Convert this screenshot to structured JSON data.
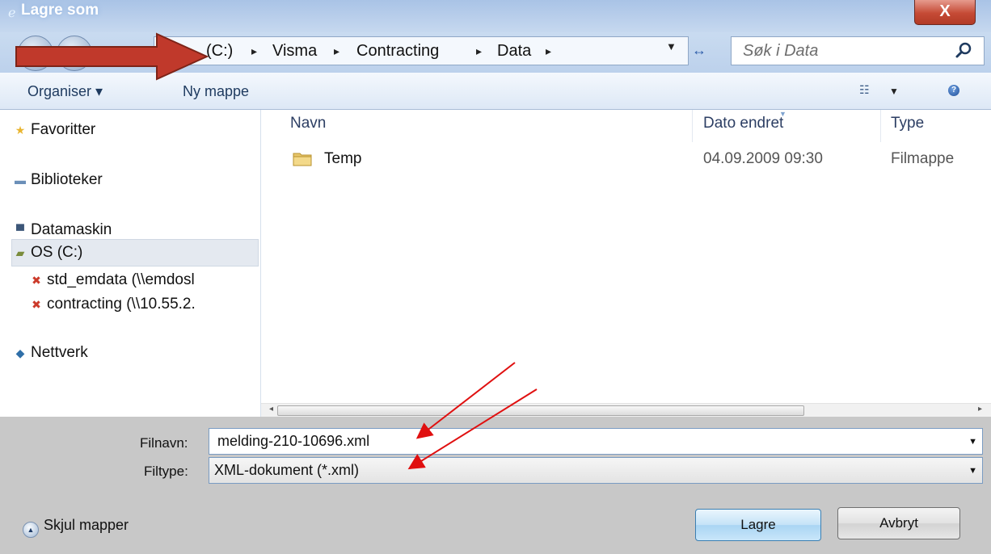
{
  "window": {
    "title": "Lagre som",
    "close_symbol": "X"
  },
  "address_bar": {
    "breadcrumbs": [
      "(C:)",
      "Visma",
      "Contracting",
      "Data"
    ],
    "separator": "▸",
    "search_placeholder": "Søk i Data"
  },
  "toolbar": {
    "organize_label": "Organiser ▾",
    "new_folder_label": "Ny mappe"
  },
  "sidebar": {
    "favorites": "Favoritter",
    "libraries": "Biblioteker",
    "computer": "Datamaskin",
    "drive_c": "OS (C:)",
    "net_drive_1": "std_emdata (\\\\emdosl",
    "net_drive_2": "contracting (\\\\10.55.2.",
    "network": "Nettverk"
  },
  "file_list": {
    "columns": [
      "Navn",
      "Dato endret",
      "Type"
    ],
    "rows": [
      {
        "name": "Temp",
        "modified": "04.09.2009 09:30",
        "type": "Filmappe"
      }
    ]
  },
  "form": {
    "filename_label": "Filnavn:",
    "filename_value": "melding-210-10696.xml",
    "filetype_label": "Filtype:",
    "filetype_value": "XML-dokument (*.xml)"
  },
  "footer": {
    "hide_folders": "Skjul mapper",
    "save": "Lagre",
    "cancel": "Avbryt"
  },
  "colors": {
    "annotation_red": "#ff0000",
    "save_button_border": "#3c7fb1",
    "bottom_panel": "#c8c8c8"
  }
}
